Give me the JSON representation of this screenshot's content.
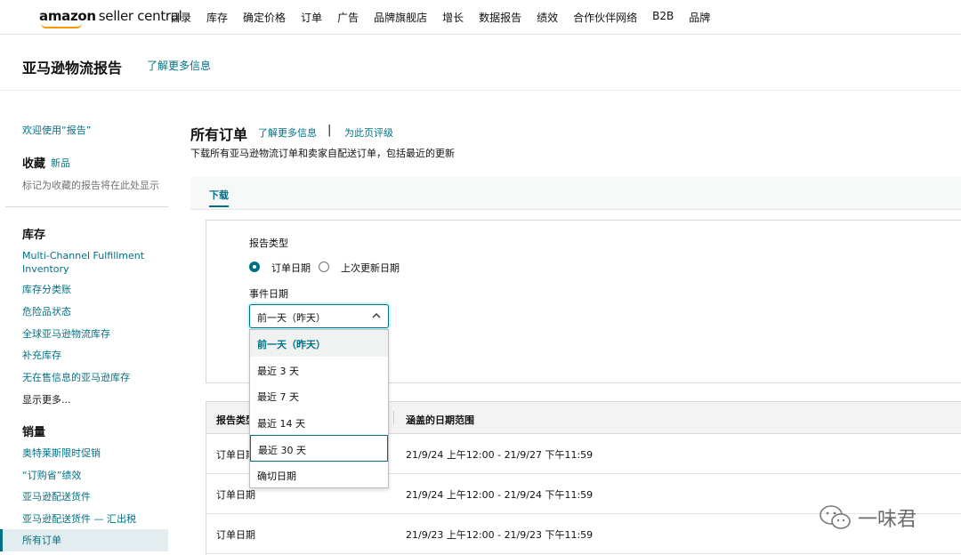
{
  "topnav": {
    "logo_main": "amazon",
    "logo_suffix": "seller central",
    "items": [
      "目录",
      "库存",
      "确定价格",
      "订单",
      "广告",
      "品牌旗舰店",
      "增长",
      "数据报告",
      "绩效",
      "合作伙伴网络",
      "B2B",
      "品牌"
    ]
  },
  "page": {
    "title": "亚马逊物流报告",
    "learn_more": "了解更多信息"
  },
  "sidebar": {
    "welcome": "欢迎使用“报告”",
    "favorites": "收藏",
    "favorites_badge": "新品",
    "favorites_hint": "标记为收藏的报告将在此处显示",
    "inventory_head": "库存",
    "inventory_items": [
      "Multi-Channel Fulfillment",
      "Inventory",
      "库存分类账",
      "危险品状态",
      "全球亚马逊物流库存",
      "补充库存",
      "无在售信息的亚马逊库存"
    ],
    "show_more": "显示更多...",
    "sales_head": "销量",
    "sales_items": [
      "奥特莱斯限时促销",
      "“订购省”绩效",
      "亚马逊配送货件",
      "亚马逊配送货件 — 汇出税",
      "所有订单"
    ]
  },
  "main": {
    "title": "所有订单",
    "learn_more": "了解更多信息",
    "separator": "|",
    "rate_page": "为此页评级",
    "description": "下载所有亚马逊物流订单和卖家自配送订单，包括最近的更新",
    "tab_download": "下载",
    "report_type_label": "报告类型",
    "radio_order_date": "订单日期",
    "radio_last_update": "上次更新日期",
    "event_date_label": "事件日期",
    "select_value": "前一天（昨天）",
    "dropdown_options": [
      "前一天（昨天）",
      "最近 3 天",
      "最近 7 天",
      "最近 14 天",
      "最近 30 天",
      "确切日期"
    ]
  },
  "table": {
    "headers": [
      "报告类型",
      "涵盖的日期范围"
    ],
    "rows": [
      {
        "type": "订单日期",
        "range": "21/9/24 上午12:00 - 21/9/27 下午11:59"
      },
      {
        "type": "订单日期",
        "range": "21/9/24 上午12:00 - 21/9/24 下午11:59"
      },
      {
        "type": "订单日期",
        "range": "21/9/23 上午12:00 - 21/9/23 下午11:59"
      }
    ]
  },
  "watermark": {
    "text": "一味君",
    "icon": "wechat-icon"
  },
  "colors": {
    "link": "#007185",
    "brand_orange": "#ff9900",
    "active_bg": "#e3ecee"
  }
}
